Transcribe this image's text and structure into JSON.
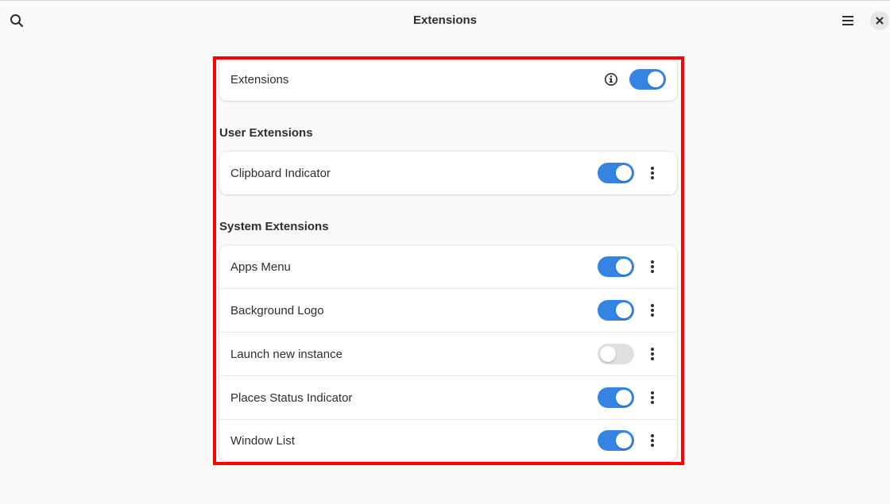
{
  "window": {
    "title": "Extensions",
    "icons": {
      "search": "search-icon",
      "menu": "hamburger-menu-icon",
      "close": "close-icon"
    }
  },
  "master": {
    "label": "Extensions",
    "info_icon": "info-icon",
    "enabled": true
  },
  "user_extensions": {
    "title": "User Extensions",
    "items": [
      {
        "label": "Clipboard Indicator",
        "enabled": true
      }
    ]
  },
  "system_extensions": {
    "title": "System Extensions",
    "items": [
      {
        "label": "Apps Menu",
        "enabled": true
      },
      {
        "label": "Background Logo",
        "enabled": true
      },
      {
        "label": "Launch new instance",
        "enabled": false
      },
      {
        "label": "Places Status Indicator",
        "enabled": true
      },
      {
        "label": "Window List",
        "enabled": true
      }
    ]
  },
  "colors": {
    "accent": "#3584e4",
    "switch_off": "#e0e0e0",
    "highlight_border": "#ff0000",
    "background": "#fafafa"
  }
}
